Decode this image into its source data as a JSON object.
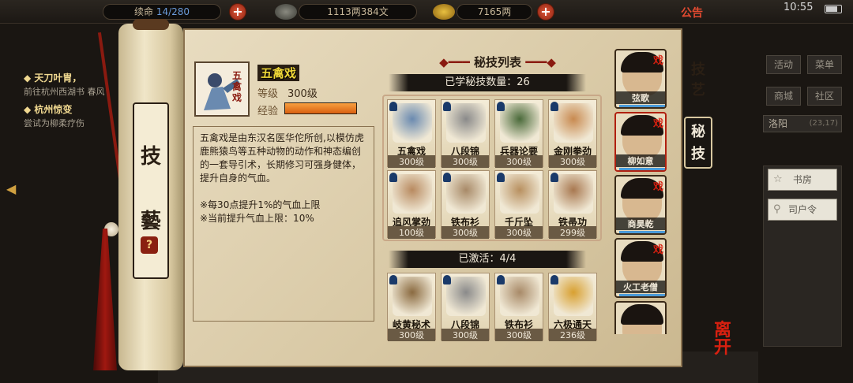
{
  "topbar": {
    "res1_label": "续命",
    "res1_value": "14/280",
    "silver": "1113两384文",
    "gold": "7165两",
    "notice": "公告",
    "clock": "10:55"
  },
  "quests": [
    {
      "title": "◆ 天刀叶胄，",
      "desc": "前往杭州西湖书 春风"
    },
    {
      "title": "◆ 杭州惊变",
      "desc": "尝试为柳柔疗伤"
    }
  ],
  "scroll": {
    "char1": "技",
    "char2": "藝",
    "help": "?"
  },
  "skill": {
    "name": "五禽戏",
    "level_label": "等级",
    "level_value": "300级",
    "exp_label": "经验",
    "exp_fraction": 1.0,
    "description": "五禽戏是由东汉名医华佗所创,以模仿虎鹿熊猿鸟等五种动物的动作和神态编创的一套导引术，长期修习可强身健体，提升自身的气血。",
    "bonus1": "※每30点提升1%的气血上限",
    "bonus2": "※当前提升气血上限：10%"
  },
  "list": {
    "title": "秘技列表",
    "learned_label": "已学秘技数量：26",
    "activated_label": "已激活：4/4",
    "learned": [
      {
        "name": "五禽戏",
        "level": "300级",
        "color": "#6a8ab0"
      },
      {
        "name": "八段锦",
        "level": "300级",
        "color": "#8a8a8a"
      },
      {
        "name": "兵器论要",
        "level": "300级",
        "color": "#4a6a3a"
      },
      {
        "name": "金刚拳劲",
        "level": "300级",
        "color": "#c88a50"
      },
      {
        "name": "追风掌劲",
        "level": "100级",
        "color": "#b88a60"
      },
      {
        "name": "铁布衫",
        "level": "300级",
        "color": "#a88a68"
      },
      {
        "name": "千斤坠",
        "level": "300级",
        "color": "#b89060"
      },
      {
        "name": "铁帚功",
        "level": "299级",
        "color": "#a87850"
      }
    ],
    "activated": [
      {
        "name": "岐黄秘术",
        "level": "300级",
        "color": "#8a6a40"
      },
      {
        "name": "八段锦",
        "level": "300级",
        "color": "#8a8a8a"
      },
      {
        "name": "铁布衫",
        "level": "300级",
        "color": "#a88a68"
      },
      {
        "name": "六极通天",
        "level": "236级",
        "color": "#d8a030"
      }
    ]
  },
  "roster": [
    {
      "name": "弦歌",
      "badge": "戏"
    },
    {
      "name": "柳如意",
      "badge": "戏"
    },
    {
      "name": "商昊乾",
      "badge": "戏"
    },
    {
      "name": "火工老僧",
      "badge": "戏"
    },
    {
      "name": "",
      "badge": ""
    }
  ],
  "tabs": {
    "arts": "技艺",
    "secret": "秘技"
  },
  "exit_label": "离开",
  "menu": {
    "activity": "活动",
    "menu": "菜单",
    "shop": "商城",
    "community": "社区",
    "location": "洛阳",
    "coords": "(23,17)",
    "study": "书房",
    "order": "司户令"
  }
}
